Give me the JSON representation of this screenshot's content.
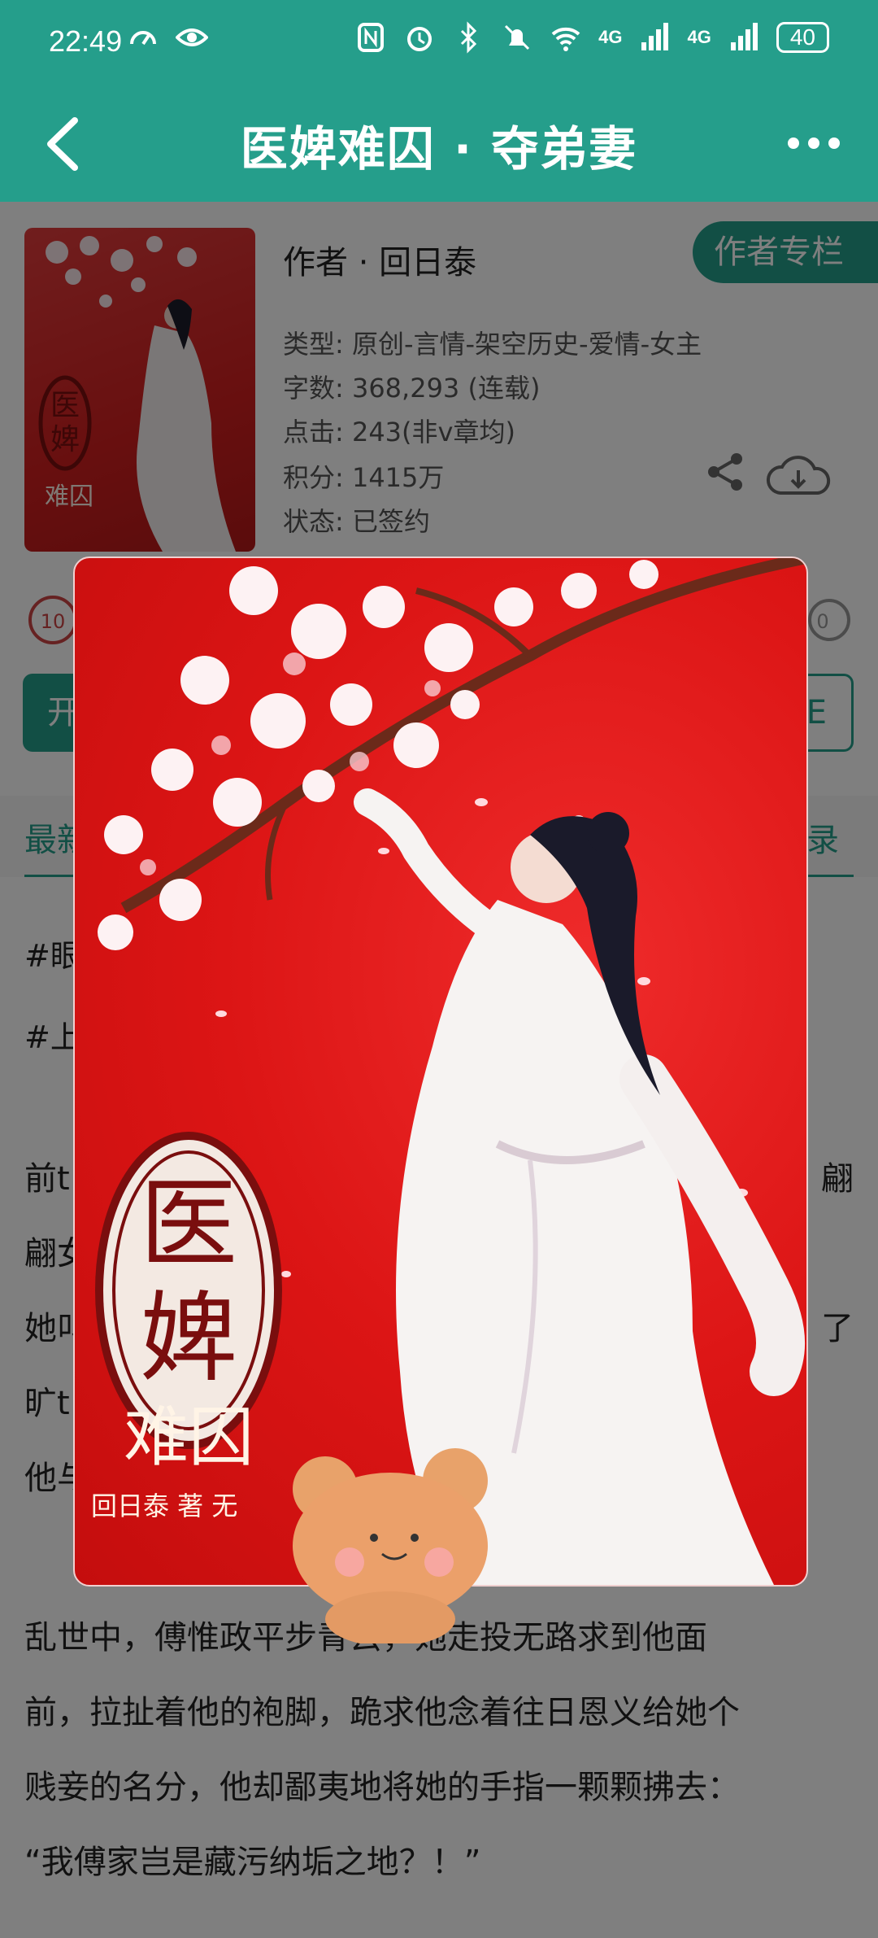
{
  "status_bar": {
    "time": "22:49",
    "network_1": "4G",
    "network_2": "4G",
    "battery": "40"
  },
  "header": {
    "title": "医婢难囚 · 夺弟妻",
    "back_icon": "back-chevron-icon",
    "more_icon": "more-dots-icon"
  },
  "book": {
    "author": "作者 · 回日泰",
    "author_column_label": "作者专栏",
    "type": "类型: 原创-言情-架空历史-爱情-女主",
    "word_count": "字数: 368,293 (连载)",
    "clicks": "点击: 243(非v章均)",
    "score": "积分: 1415万",
    "status": "状态: 已签约",
    "stats_left": "10",
    "stats_right": "0"
  },
  "actions": {
    "start_reading": "开",
    "add_label": "E"
  },
  "tabs": {
    "latest": "最新",
    "catalog": "录"
  },
  "intro": {
    "tag_1": "#眼",
    "tag_2": "#上",
    "line_1_start": "前t",
    "line_1_end": "翩",
    "line_2_start": "翩女",
    "line_3_start": "她叫",
    "line_3_end": "了",
    "line_4_start": "旷t",
    "line_5_start": "他与",
    "para_2_line_1": "乱世中，傅惟政平步青云，她走投无路求到他面",
    "para_2_line_2": "前，拉扯着他的袍脚，跪求他念着往日恩义给她个",
    "para_2_line_3": "贱妾的名分，他却鄙夷地将她的手指一颗颗拂去：",
    "para_2_line_4": "“我傅家岂是藏污纳垢之地？！”"
  },
  "cover": {
    "title_big_1": "医",
    "title_big_2": "婢",
    "title_small": "难囚",
    "byline": "回日泰 著 无"
  },
  "colors": {
    "accent": "#259e8b",
    "cover_red": "#dc1515"
  }
}
